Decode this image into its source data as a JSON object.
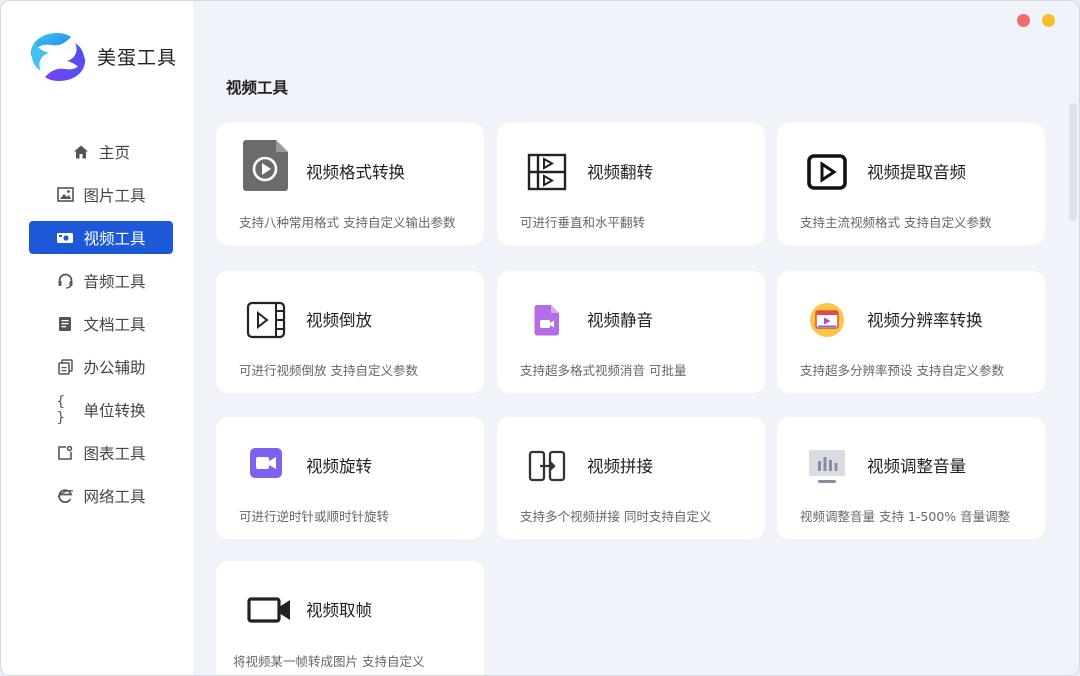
{
  "app": {
    "name": "美蛋工具"
  },
  "sidebar": {
    "items": [
      {
        "label": "主页",
        "icon": "home-icon"
      },
      {
        "label": "图片工具",
        "icon": "image-icon"
      },
      {
        "label": "视频工具",
        "icon": "video-icon",
        "active": true
      },
      {
        "label": "音频工具",
        "icon": "headset-icon"
      },
      {
        "label": "文档工具",
        "icon": "document-icon"
      },
      {
        "label": "办公辅助",
        "icon": "copy-icon"
      },
      {
        "label": "单位转换",
        "icon": "braces-icon"
      },
      {
        "label": "图表工具",
        "icon": "chart-icon"
      },
      {
        "label": "网络工具",
        "icon": "browser-icon"
      }
    ]
  },
  "main": {
    "section_title": "视频工具",
    "cards": [
      {
        "title": "视频格式转换",
        "desc": "支持八种常用格式 支持自定义输出参数",
        "icon": "video-file-icon"
      },
      {
        "title": "视频翻转",
        "desc": "可进行垂直和水平翻转",
        "icon": "flip-icon"
      },
      {
        "title": "视频提取音频",
        "desc": "支持主流视频格式 支持自定义参数",
        "icon": "play-box-icon"
      },
      {
        "title": "视频倒放",
        "desc": "可进行视频倒放 支持自定义参数",
        "icon": "reverse-play-icon"
      },
      {
        "title": "视频静音",
        "desc": "支持超多格式视频消音 可批量",
        "icon": "mute-file-icon"
      },
      {
        "title": "视频分辨率转换",
        "desc": "支持超多分辨率预设 支持自定义参数",
        "icon": "resolution-icon"
      },
      {
        "title": "视频旋转",
        "desc": "可进行逆时针或顺时针旋转",
        "icon": "rotate-camera-icon"
      },
      {
        "title": "视频拼接",
        "desc": "支持多个视频拼接 同时支持自定义",
        "icon": "splice-icon"
      },
      {
        "title": "视频调整音量",
        "desc": "视频调整音量 支持 1-500% 音量调整",
        "icon": "volume-bars-icon"
      },
      {
        "title": "视频取帧",
        "desc": "将视频某一帧转成图片  支持自定义",
        "icon": "camera-icon"
      }
    ]
  },
  "colors": {
    "accent": "#1c58d8",
    "window_close": "#f56a6a",
    "window_minimize": "#f6be2f"
  }
}
